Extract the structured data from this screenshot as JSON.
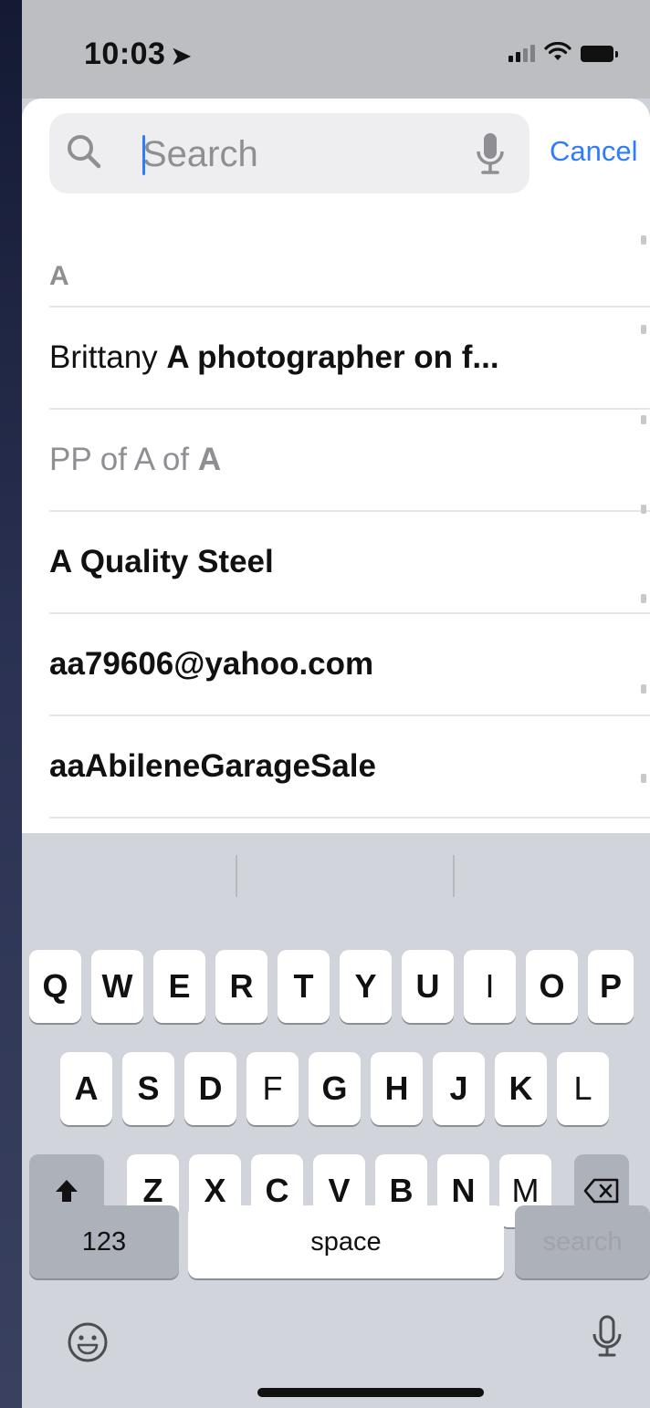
{
  "status_bar": {
    "time": "10:03",
    "location_icon": "location-arrow-icon",
    "signal_icon": "cellular-signal-icon",
    "wifi_icon": "wifi-icon",
    "battery_icon": "battery-icon"
  },
  "search": {
    "placeholder": "Search",
    "value": "",
    "search_icon": "magnifying-glass-icon",
    "dictation_icon": "microphone-icon",
    "cancel_label": "Cancel"
  },
  "results": {
    "section_letter": "A",
    "rows": [
      {
        "normal": "Brittany ",
        "bold": "A photographer on f..."
      },
      {
        "muted": "PP of A of ",
        "muted_bold": "A"
      },
      {
        "bold": "A Quality Steel"
      },
      {
        "bold": "aa79606@yahoo.com"
      },
      {
        "bold": "aaAbileneGarageSale"
      }
    ]
  },
  "keyboard": {
    "row1": [
      "Q",
      "W",
      "E",
      "R",
      "T",
      "Y",
      "U",
      "I",
      "O",
      "P"
    ],
    "row2": [
      "A",
      "S",
      "D",
      "F",
      "G",
      "H",
      "J",
      "K",
      "L"
    ],
    "row3": [
      "Z",
      "X",
      "C",
      "V",
      "B",
      "N",
      "M"
    ],
    "shift_icon": "shift-arrow-icon",
    "delete_icon": "backspace-icon",
    "numbers_label": "123",
    "space_label": "space",
    "search_label": "search",
    "emoji_icon": "emoji-icon",
    "dictation_icon": "microphone-icon"
  },
  "colors": {
    "accent": "#2f7cf6",
    "sheet": "#ffffff",
    "keyboard_bg": "#d1d4da",
    "key": "#ffffff",
    "function_key": "#adb1b9"
  }
}
